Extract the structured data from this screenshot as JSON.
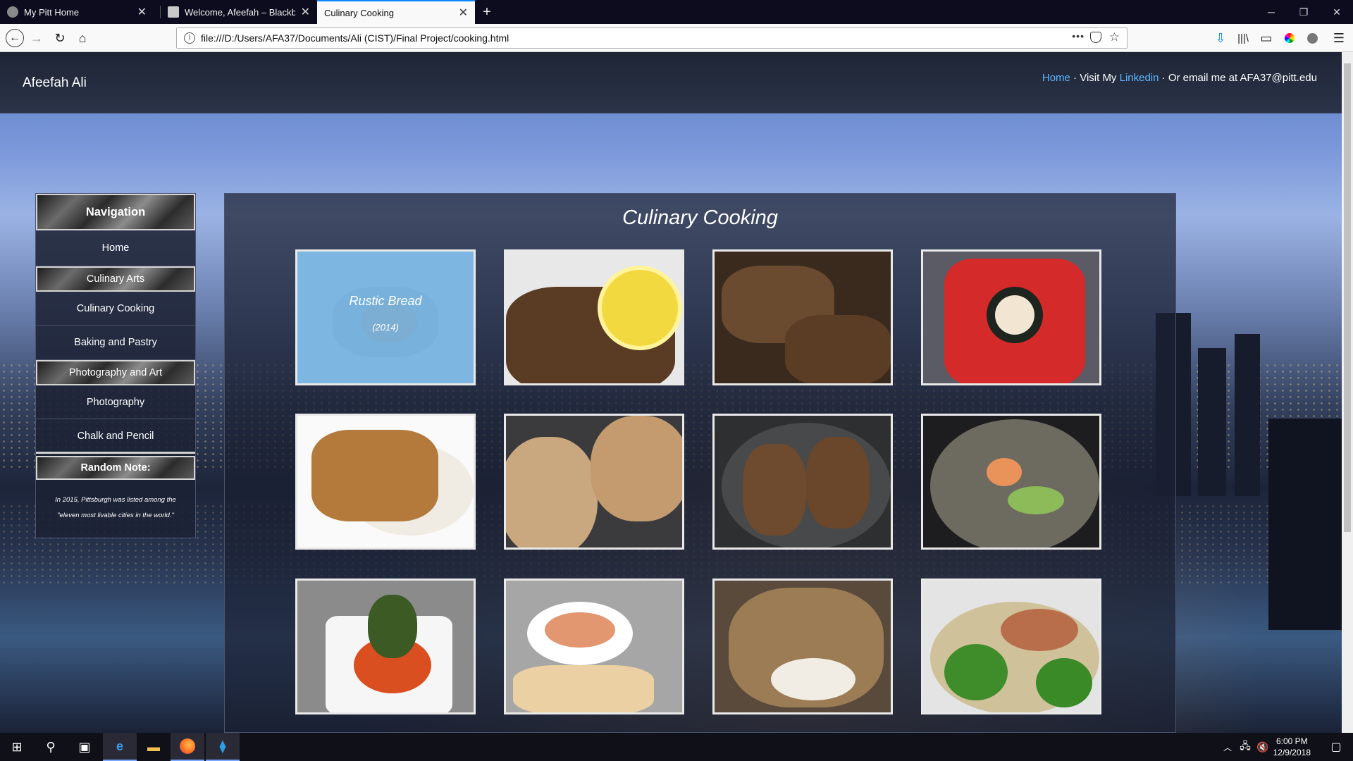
{
  "browser": {
    "tabs": [
      {
        "label": "My Pitt Home",
        "active": false
      },
      {
        "label": "Welcome, Afeefah – Blackboard",
        "active": false
      },
      {
        "label": "Culinary Cooking",
        "active": true
      }
    ],
    "new_tab_label": "+",
    "url": "file:///D:/Users/AFA37/Documents/Ali (CIST)/Final Project/cooking.html",
    "url_actions": [
      "•••",
      "pocket-icon",
      "bookmark-star-icon"
    ]
  },
  "header": {
    "site_name": "Afeefah Ali",
    "home_link": "Home",
    "sep1": " · Visit My ",
    "linkedin_link": "Linkedin",
    "sep2": " · Or email me at AFA37@pitt.edu"
  },
  "sidebar": {
    "heading": "Navigation",
    "items": [
      {
        "label": "Home",
        "type": "link"
      },
      {
        "label": "Culinary Arts",
        "type": "section"
      },
      {
        "label": "Culinary Cooking",
        "type": "link"
      },
      {
        "label": "Baking and Pastry",
        "type": "link"
      },
      {
        "label": "Photography and Art",
        "type": "section"
      },
      {
        "label": "Photography",
        "type": "link"
      },
      {
        "label": "Chalk and Pencil",
        "type": "link"
      }
    ],
    "note_heading": "Random Note:",
    "note_text": "In 2015, Pittsburgh was listed among the \"eleven most livable cities in the world.\""
  },
  "content": {
    "title": "Culinary Cooking",
    "gallery": [
      {
        "name": "rustic-bread",
        "overlay_title": "Rustic Bread",
        "overlay_year": "(2014)"
      },
      {
        "name": "blackened-fish-lemon"
      },
      {
        "name": "seared-steak"
      },
      {
        "name": "sushi-roll"
      },
      {
        "name": "fish-over-rice"
      },
      {
        "name": "seasoned-chicken-breasts"
      },
      {
        "name": "pan-seared-fish"
      },
      {
        "name": "shrimp-in-pan"
      },
      {
        "name": "stuffed-pepper"
      },
      {
        "name": "soup-and-pita"
      },
      {
        "name": "seared-fish-fillet"
      },
      {
        "name": "salmon-with-pasta"
      }
    ]
  },
  "taskbar": {
    "time": "6:00 PM",
    "date": "12/9/2018"
  },
  "colors": {
    "link": "#5db7ff",
    "overlay": "#6eb0e2",
    "active_tab_accent": "#0a84ff"
  }
}
